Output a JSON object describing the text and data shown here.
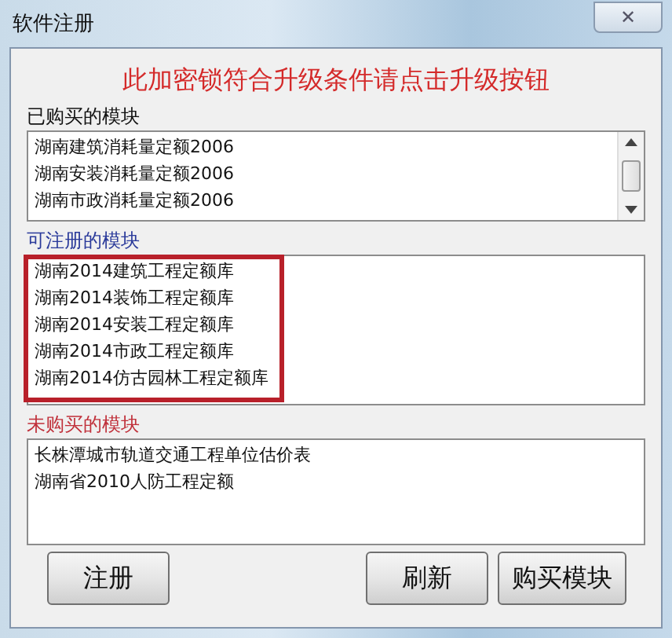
{
  "window": {
    "title": "软件注册",
    "close": "✕"
  },
  "notice": "此加密锁符合升级条件请点击升级按钮",
  "sections": [
    {
      "label": "已购买的模块",
      "color": "#111111",
      "scrollbar": true,
      "highlighted": false,
      "items": [
        "湖南建筑消耗量定额2006",
        "湖南安装消耗量定额2006",
        "湖南市政消耗量定额2006"
      ]
    },
    {
      "label": "可注册的模块",
      "color": "#2a3a9a",
      "scrollbar": false,
      "highlighted": true,
      "items": [
        "湖南2014建筑工程定额库",
        "湖南2014装饰工程定额库",
        "湖南2014安装工程定额库",
        "湖南2014市政工程定额库",
        "湖南2014仿古园林工程定额库"
      ]
    },
    {
      "label": "未购买的模块",
      "color": "#c0303a",
      "scrollbar": false,
      "highlighted": false,
      "items": [
        "长株潭城市轨道交通工程单位估价表",
        "湖南省2010人防工程定额"
      ]
    }
  ],
  "buttons_left": [
    "注册"
  ],
  "buttons_right": [
    "刷新",
    "购买模块"
  ]
}
